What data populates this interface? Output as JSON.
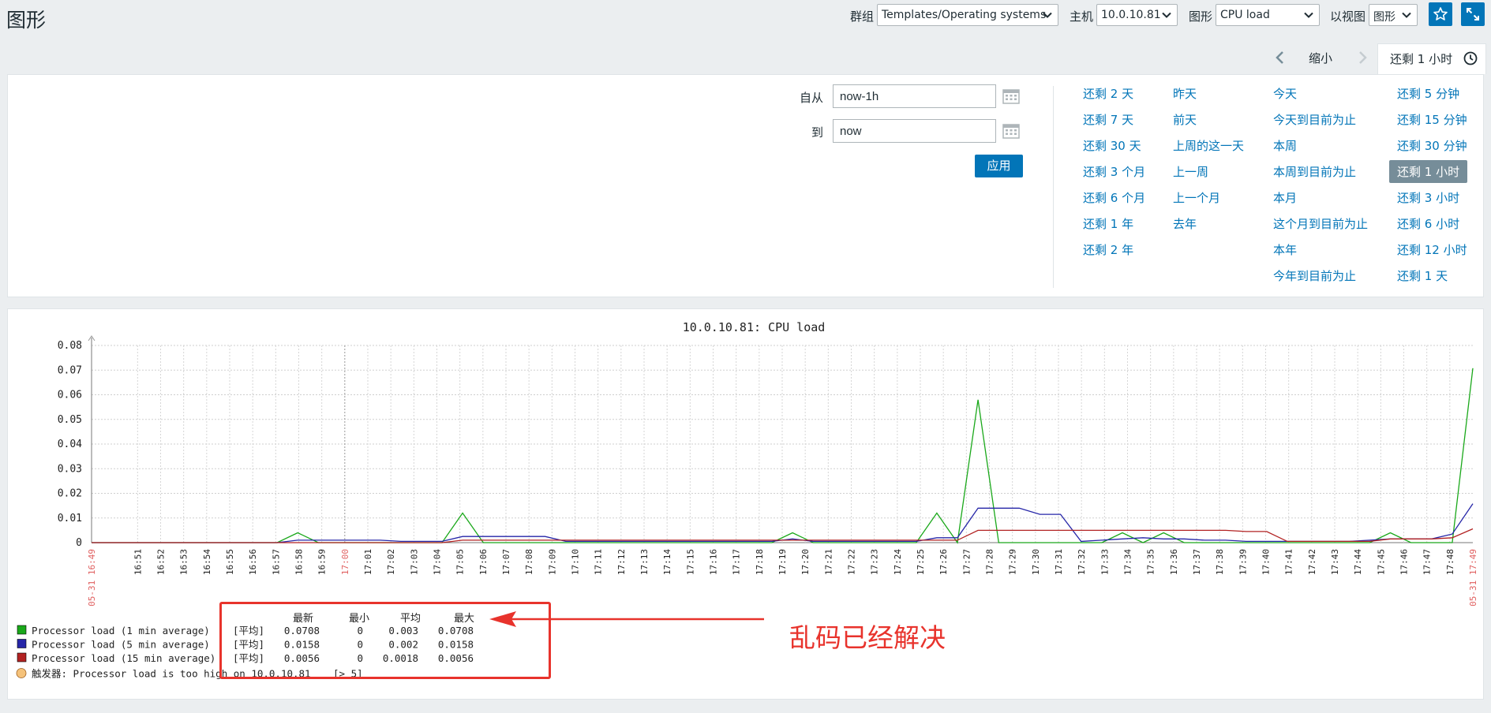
{
  "header": {
    "title": "图形",
    "group_label": "群组",
    "group_value": "Templates/Operating systems",
    "host_label": "主机",
    "host_value": "10.0.10.81",
    "graph_label": "图形",
    "graph_value": "CPU load",
    "view_label": "以视图",
    "view_value": "图形"
  },
  "timebar": {
    "zoom_out": "缩小",
    "active_tab": "还剩 1 小时"
  },
  "filter": {
    "from_label": "自从",
    "from_value": "now-1h",
    "to_label": "到",
    "to_value": "now",
    "apply": "应用",
    "quick": [
      [
        "还剩 2 天",
        "还剩 7 天",
        "还剩 30 天",
        "还剩 3 个月",
        "还剩 6 个月",
        "还剩 1 年",
        "还剩 2 年"
      ],
      [
        "昨天",
        "前天",
        "上周的这一天",
        "上一周",
        "上一个月",
        "去年"
      ],
      [
        "今天",
        "今天到目前为止",
        "本周",
        "本周到目前为止",
        "本月",
        "这个月到目前为止",
        "本年",
        "今年到目前为止"
      ],
      [
        "还剩 5 分钟",
        "还剩 15 分钟",
        "还剩 30 分钟",
        "还剩 1 小时",
        "还剩 3 小时",
        "还剩 6 小时",
        "还剩 12 小时",
        "还剩 1 天"
      ]
    ],
    "selected": "还剩 1 小时"
  },
  "chart_data": {
    "type": "line",
    "title": "10.0.10.81: CPU load",
    "ylim": [
      0,
      0.08
    ],
    "yticks": [
      "0.08",
      "0.07",
      "0.06",
      "0.05",
      "0.04",
      "0.03",
      "0.02",
      "0.01",
      "0"
    ],
    "x_start_label": "05-31 16:49",
    "x_end_label": "05-31 17:49",
    "xticks": [
      "16:51",
      "16:52",
      "16:53",
      "16:54",
      "16:55",
      "16:56",
      "16:57",
      "16:58",
      "16:59",
      "17:00",
      "17:01",
      "17:02",
      "17:03",
      "17:04",
      "17:05",
      "17:06",
      "17:07",
      "17:08",
      "17:09",
      "17:10",
      "17:11",
      "17:12",
      "17:13",
      "17:14",
      "17:15",
      "17:16",
      "17:17",
      "17:18",
      "17:19",
      "17:20",
      "17:21",
      "17:22",
      "17:23",
      "17:24",
      "17:25",
      "17:26",
      "17:27",
      "17:28",
      "17:29",
      "17:30",
      "17:31",
      "17:32",
      "17:33",
      "17:34",
      "17:35",
      "17:36",
      "17:37",
      "17:38",
      "17:39",
      "17:40",
      "17:41",
      "17:42",
      "17:43",
      "17:44",
      "17:45",
      "17:46",
      "17:47",
      "17:48",
      "17:49"
    ],
    "x_minutes": [
      49,
      50,
      51,
      52,
      53,
      54,
      55,
      56,
      57,
      58,
      59,
      60,
      61,
      62,
      63,
      64,
      65,
      66,
      67,
      68,
      69,
      70,
      71,
      72,
      73,
      74,
      75,
      76,
      77,
      78,
      79,
      80,
      81,
      82,
      83,
      84,
      85,
      86,
      87,
      88,
      89,
      90,
      91,
      92,
      93,
      94,
      95,
      96,
      97,
      98,
      99,
      100,
      101,
      102,
      103,
      104,
      105,
      106,
      107,
      108,
      109
    ],
    "series": [
      {
        "name": "Processor load (1 min average)",
        "color": "#1aa81a",
        "values": [
          0,
          0,
          0,
          0,
          0,
          0,
          0,
          0,
          0,
          0,
          0.004,
          0,
          0,
          0,
          0,
          0,
          0,
          0,
          0.012,
          0,
          0,
          0,
          0,
          0,
          0,
          0,
          0,
          0,
          0,
          0,
          0,
          0,
          0,
          0,
          0.004,
          0,
          0,
          0,
          0,
          0,
          0,
          0.012,
          0,
          0.058,
          0,
          0,
          0,
          0,
          0,
          0,
          0.004,
          0,
          0.004,
          0,
          0,
          0,
          0,
          0,
          0,
          0,
          0,
          0,
          0,
          0.004,
          0,
          0,
          0,
          0.0708
        ]
      },
      {
        "name": "Processor load (5 min average)",
        "color": "#2626a8",
        "values": [
          0,
          0,
          0,
          0,
          0,
          0,
          0,
          0,
          0,
          0,
          0.001,
          0.001,
          0.001,
          0.001,
          0.001,
          0.0005,
          0.0005,
          0.0005,
          0.0025,
          0.0025,
          0.0025,
          0.0025,
          0.0025,
          0.0005,
          0.0005,
          0.0005,
          0.0005,
          0.0005,
          0.0005,
          0.0005,
          0.0005,
          0.0005,
          0.0005,
          0.0005,
          0.0015,
          0.0005,
          0.0005,
          0.0005,
          0.0005,
          0.0005,
          0.0005,
          0.002,
          0.002,
          0.014,
          0.014,
          0.014,
          0.0115,
          0.0115,
          0.0005,
          0.001,
          0.0015,
          0.002,
          0.0015,
          0.0015,
          0.001,
          0.001,
          0.0005,
          0.0005,
          0.0005,
          0.0005,
          0.0005,
          0.0005,
          0.001,
          0.0015,
          0.0015,
          0.0015,
          0.0035,
          0.0158
        ]
      },
      {
        "name": "Processor load (15 min average)",
        "color": "#b22222",
        "values": [
          0,
          0,
          0,
          0,
          0,
          0,
          0,
          0,
          0,
          0,
          0,
          0,
          0,
          0,
          0,
          0,
          0,
          0,
          0.001,
          0.001,
          0.001,
          0.001,
          0.001,
          0.001,
          0.001,
          0.001,
          0.001,
          0.001,
          0.001,
          0.001,
          0.001,
          0.001,
          0.001,
          0.001,
          0.001,
          0.001,
          0.001,
          0.001,
          0.001,
          0.001,
          0.001,
          0.001,
          0.001,
          0.005,
          0.005,
          0.005,
          0.005,
          0.005,
          0.005,
          0.005,
          0.005,
          0.005,
          0.005,
          0.005,
          0.005,
          0.005,
          0.0045,
          0.0045,
          0.0005,
          0.0005,
          0.0005,
          0.0005,
          0.0005,
          0.0015,
          0.0015,
          0.0015,
          0.002,
          0.0056
        ]
      }
    ],
    "legend": {
      "header": [
        "最新",
        "最小",
        "平均",
        "最大"
      ],
      "rows": [
        {
          "name": "Processor load (1 min average)",
          "color": "#1aa81a",
          "func": "[平均]",
          "last": "0.0708",
          "min": "0",
          "avg": "0.003",
          "max": "0.0708"
        },
        {
          "name": "Processor load (5 min average)",
          "color": "#2626a8",
          "func": "[平均]",
          "last": "0.0158",
          "min": "0",
          "avg": "0.002",
          "max": "0.0158"
        },
        {
          "name": "Processor load (15 min average)",
          "color": "#b22222",
          "func": "[平均]",
          "last": "0.0056",
          "min": "0",
          "avg": "0.0018",
          "max": "0.0056"
        }
      ],
      "trigger": "触发器: Processor load is too high on 10.0.10.81",
      "trigger_cond": "[> 5]"
    }
  },
  "annotation": {
    "text": "乱码已经解决"
  }
}
